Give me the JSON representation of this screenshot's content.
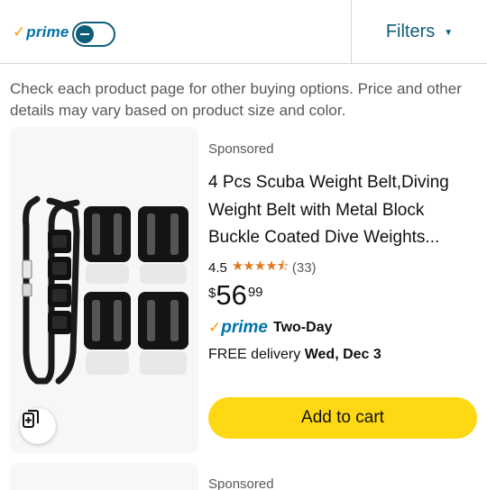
{
  "header": {
    "prime_check": "✓",
    "prime_label": "prime",
    "toggle_state": "off",
    "filters_label": "Filters",
    "filters_caret": "▼"
  },
  "notice": "Check each product page for other buying options. Price and other details may vary based on product size and color.",
  "product": {
    "sponsored_label": "Sponsored",
    "title": "4 Pcs Scuba Weight Belt,Diving Weight Belt with Metal Block Buckle Coated Dive Weights...",
    "rating_value": "4.5",
    "stars": "★★★★⯪",
    "rating_count": "(33)",
    "price_symbol": "$",
    "price_whole": "56",
    "price_fraction": "99",
    "prime_check": "✓",
    "prime_label": "prime",
    "prime_speed": "Two-Day",
    "delivery_prefix": "FREE delivery ",
    "delivery_date": "Wed, Dec 3",
    "add_to_cart_label": "Add to cart",
    "compare_icon": "compare-add-icon"
  },
  "next_product": {
    "sponsored_label": "Sponsored"
  },
  "colors": {
    "prime_orange": "#ff9900",
    "prime_blue": "#0073a8",
    "teal": "#0f5e78",
    "cart_yellow": "#ffd814",
    "star_orange": "#de7921"
  }
}
